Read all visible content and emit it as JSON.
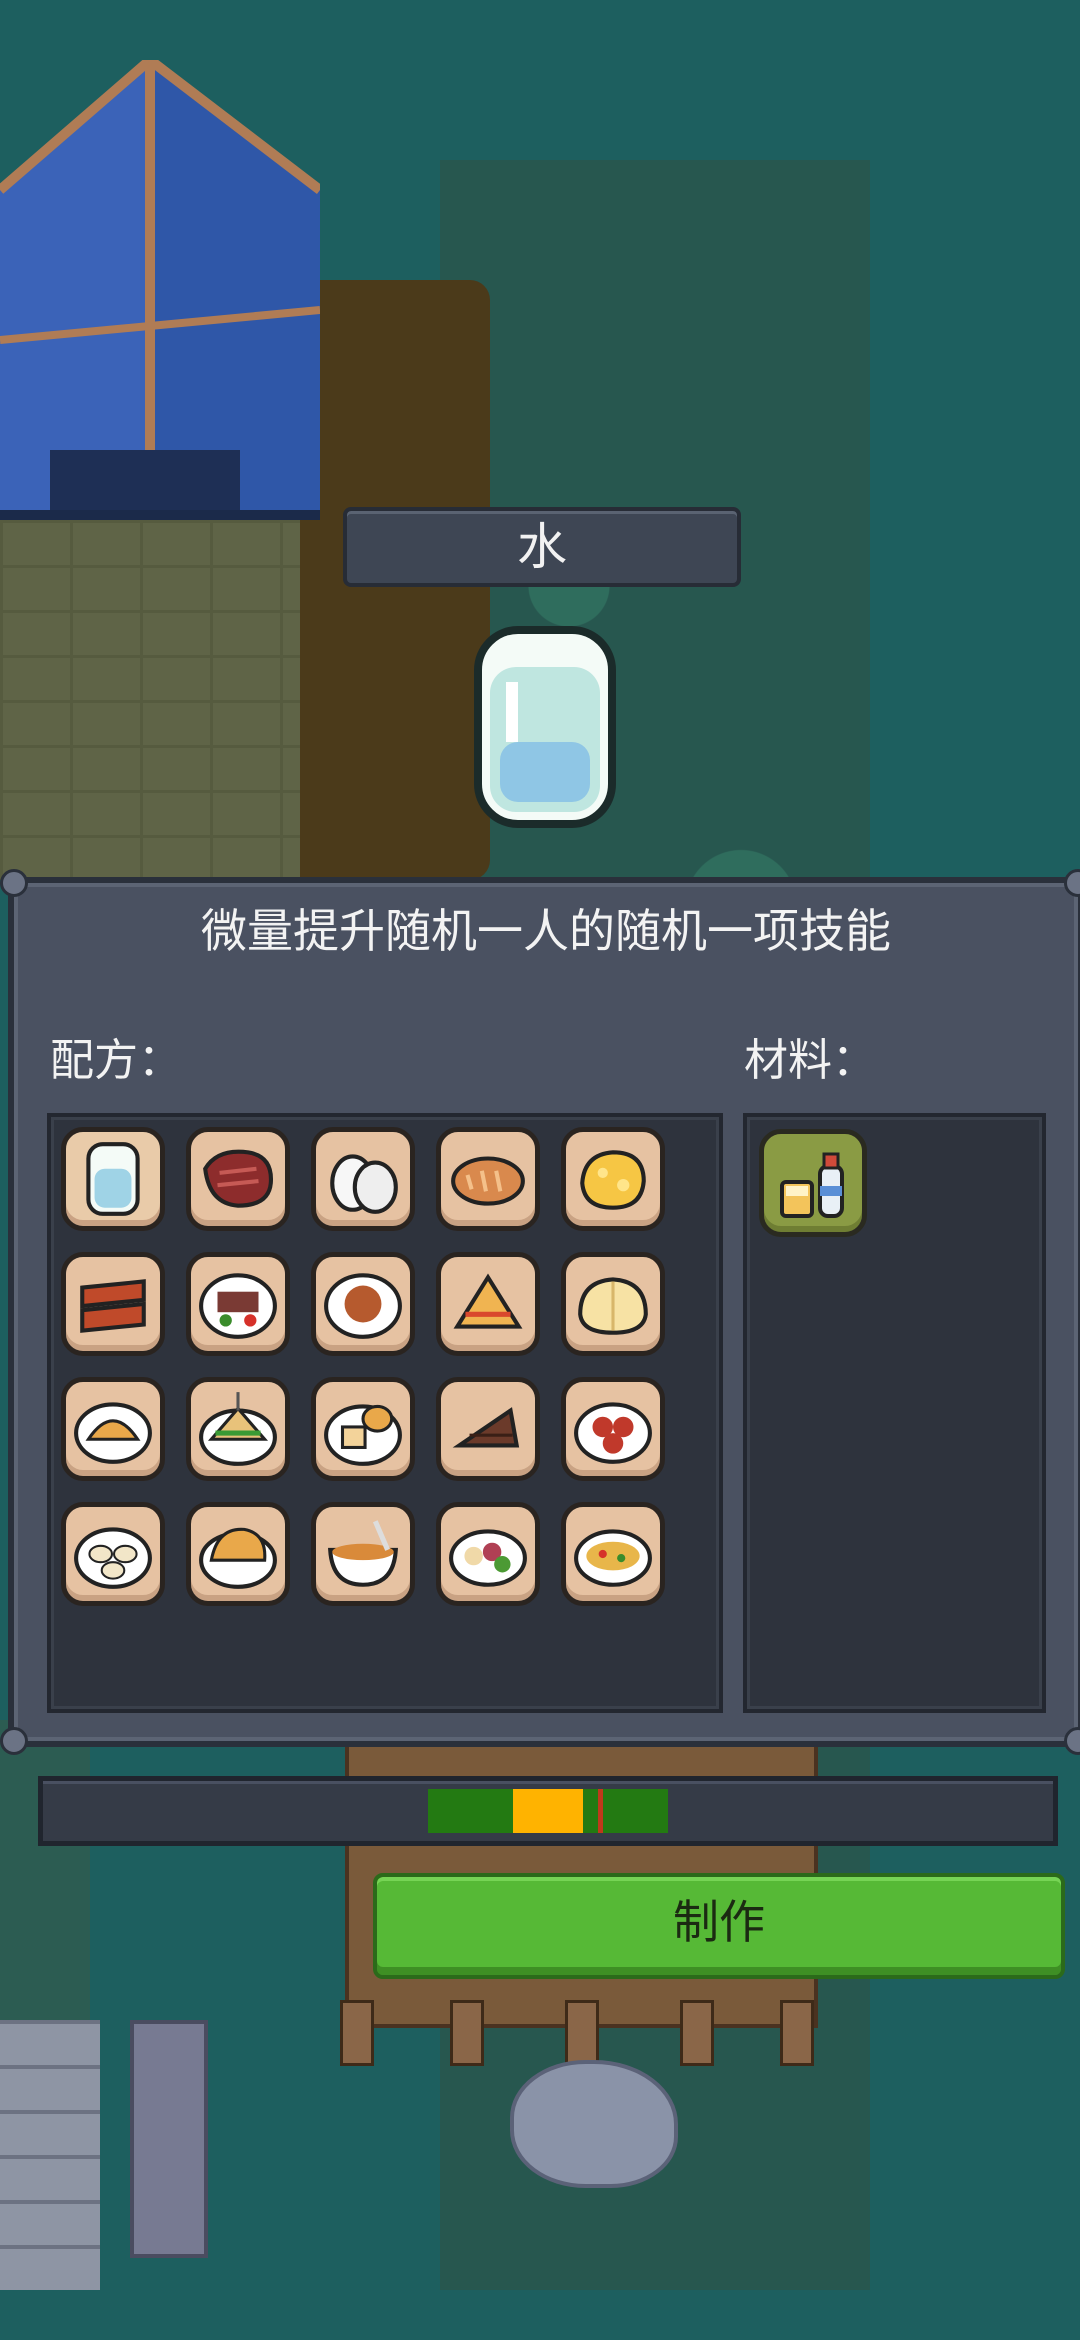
{
  "item": {
    "name": "水",
    "icon": "water-glass-icon",
    "description": "微量提升随机一人的随机一项技能"
  },
  "labels": {
    "recipe": "配方：",
    "materials": "材料："
  },
  "recipes": [
    {
      "icon": "water-glass-icon"
    },
    {
      "icon": "steak-icon"
    },
    {
      "icon": "eggs-icon"
    },
    {
      "icon": "bread-rolls-icon"
    },
    {
      "icon": "scrambled-egg-icon"
    },
    {
      "icon": "bacon-icon"
    },
    {
      "icon": "meat-plate-icon"
    },
    {
      "icon": "pasta-plate-icon"
    },
    {
      "icon": "toast-sandwich-icon"
    },
    {
      "icon": "bread-loaf-icon"
    },
    {
      "icon": "taco-plate-icon"
    },
    {
      "icon": "sandwich-icon"
    },
    {
      "icon": "bread-plate-icon"
    },
    {
      "icon": "chocolate-cake-icon"
    },
    {
      "icon": "meatballs-icon"
    },
    {
      "icon": "dumplings-icon"
    },
    {
      "icon": "fried-rice-icon"
    },
    {
      "icon": "noodle-soup-icon"
    },
    {
      "icon": "salad-bowl-icon"
    },
    {
      "icon": "stir-fry-icon"
    }
  ],
  "materials": [
    {
      "icon": "cup-and-bottle-icon"
    }
  ],
  "timing": {
    "green_zone": [
      0.38,
      0.62
    ],
    "yellow_zone": [
      0.465,
      0.535
    ],
    "marker": 0.55
  },
  "make_button": "制作",
  "colors": {
    "accent_green": "#56b936",
    "zone_green": "#237a12",
    "zone_yellow": "#ffb300",
    "marker_red": "#c0391b"
  }
}
